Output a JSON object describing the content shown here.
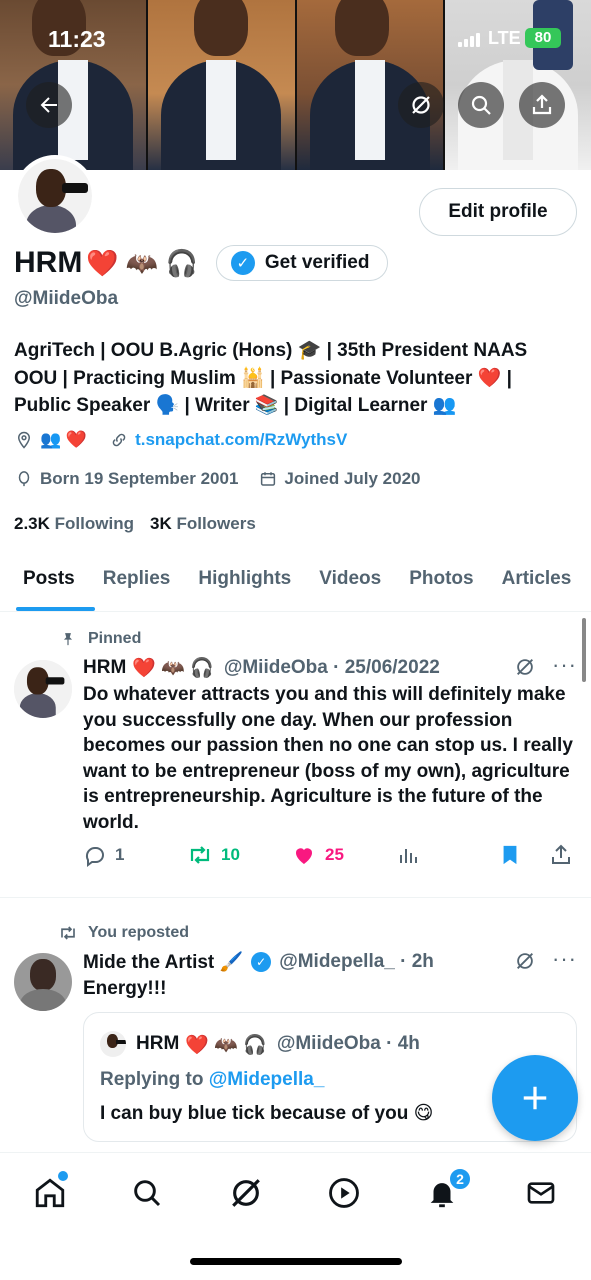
{
  "status_bar": {
    "time": "11:23",
    "network": "LTE",
    "battery": "80"
  },
  "profile": {
    "name": "HRM",
    "name_emojis": "❤️ 🦇 🎧",
    "handle": "@MiideOba",
    "edit_label": "Edit profile",
    "verify_label": "Get verified",
    "bio_lines": [
      "AgriTech | OOU B.Agric (Hons) 🎓 | 35th President NAAS",
      "OOU | Practicing Muslim 🕌 | Passionate Volunteer ❤️ |",
      "Public Speaker 🗣️ | Writer 📚 | Digital Learner 👥"
    ],
    "location_emojis": "👥 ❤️",
    "link": "t.snapchat.com/RzWythsV",
    "born": "Born 19 September 2001",
    "joined": "Joined July 2020",
    "following_count": "2.3K",
    "following_label": "Following",
    "followers_count": "3K",
    "followers_label": "Followers"
  },
  "tabs": [
    "Posts",
    "Replies",
    "Highlights",
    "Videos",
    "Photos",
    "Articles"
  ],
  "pinned_post": {
    "label": "Pinned",
    "name": "HRM",
    "emojis": "❤️ 🦇 🎧",
    "handle_date": "@MiideOba · 25/06/2022",
    "text": "Do whatever attracts you and this will definitely make you successfully one day. When our profession becomes our passion then no one can stop us. I really  want to be entrepreneur (boss of my own), agriculture is entrepreneurship. Agriculture is the future of the world.",
    "replies": "1",
    "reposts": "10",
    "likes": "25"
  },
  "repost": {
    "label": "You reposted",
    "name": "Mide the Artist 🖌️",
    "handle_time": "@Midepella_ · 2h",
    "text": "Energy!!!",
    "quote": {
      "name": "HRM",
      "emojis": "❤️ 🦇 🎧",
      "handle_time": "@MiideOba · 4h",
      "replying_prefix": "Replying to",
      "replying_handle": "@Midepella_",
      "text": "I can buy blue tick because of you 😋"
    }
  },
  "notifications_badge": "2",
  "colors": {
    "accent": "#1d9bf0",
    "like": "#f91880",
    "repost": "#00ba7c",
    "text": "#0f1419",
    "muted": "#536471"
  }
}
